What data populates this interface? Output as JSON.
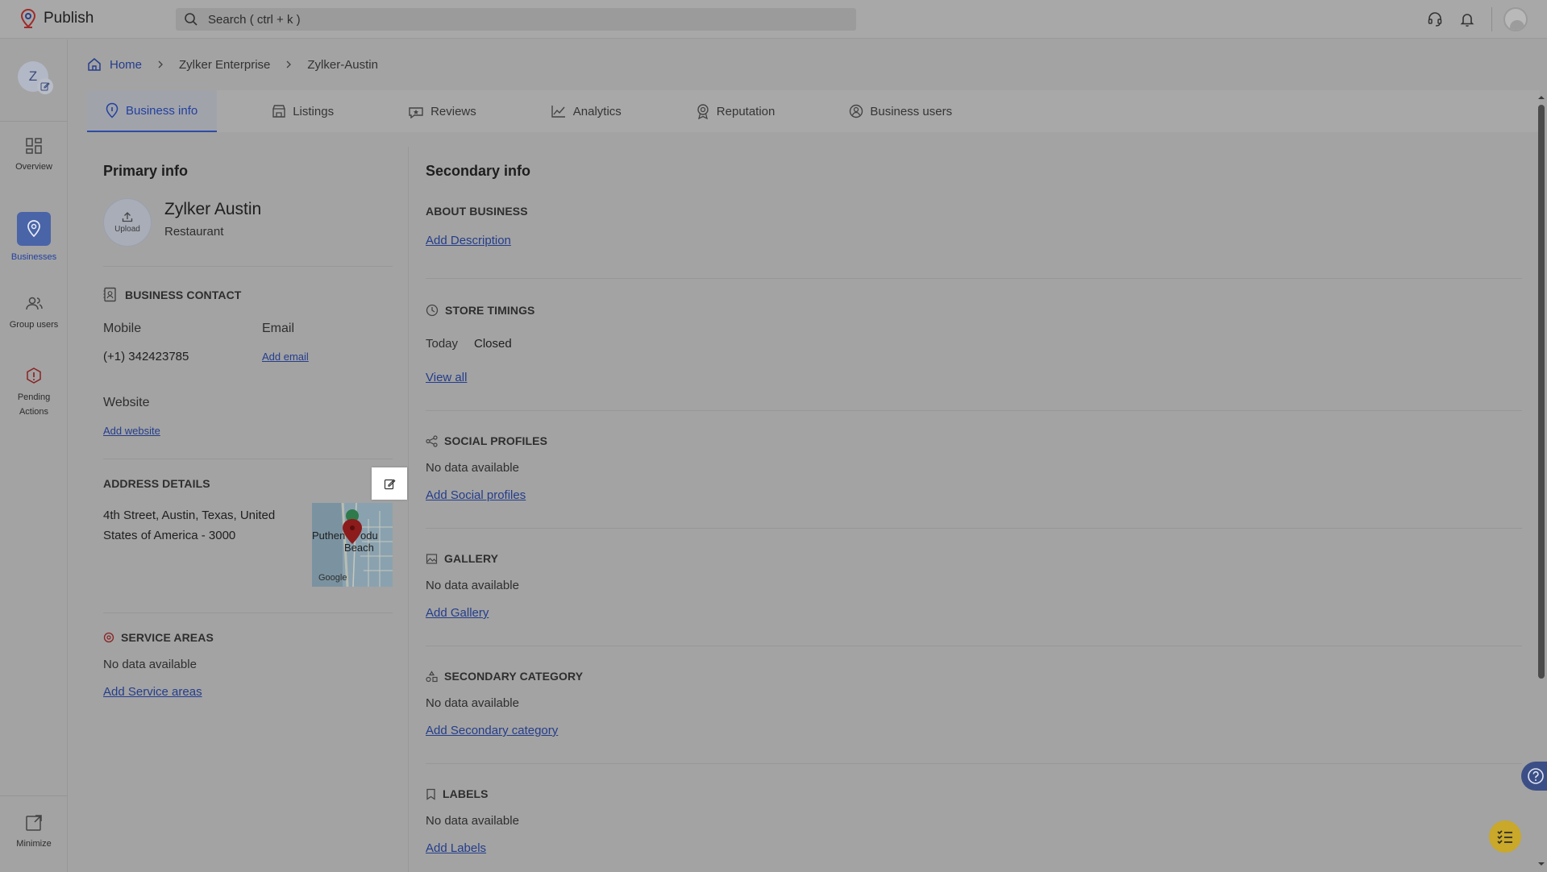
{
  "app": {
    "title": "Publish"
  },
  "search": {
    "placeholder": "Search ( ctrl + k )"
  },
  "rail": {
    "avatar_letter": "Z",
    "items": [
      {
        "label": "Overview",
        "icon": "grid-icon"
      },
      {
        "label": "Businesses",
        "icon": "location-pin-icon",
        "active": true
      },
      {
        "label": "Group users",
        "icon": "users-icon"
      },
      {
        "label": "Pending Actions",
        "icon": "alert-icon"
      }
    ],
    "minimize_label": "Minimize"
  },
  "breadcrumb": {
    "home": "Home",
    "level1": "Zylker Enterprise",
    "level2": "Zylker-Austin"
  },
  "tabs": [
    {
      "label": "Business info",
      "icon": "info-pin-icon",
      "active": true
    },
    {
      "label": "Listings",
      "icon": "store-icon"
    },
    {
      "label": "Reviews",
      "icon": "reviews-icon"
    },
    {
      "label": "Analytics",
      "icon": "analytics-icon"
    },
    {
      "label": "Reputation",
      "icon": "reputation-icon"
    },
    {
      "label": "Business users",
      "icon": "business-users-icon"
    }
  ],
  "primary": {
    "heading": "Primary info",
    "upload_label": "Upload",
    "business_name": "Zylker Austin",
    "business_category": "Restaurant",
    "contact": {
      "title": "BUSINESS CONTACT",
      "mobile_label": "Mobile",
      "mobile_value": "(+1) 342423785",
      "email_label": "Email",
      "email_link": "Add email",
      "website_label": "Website",
      "website_link": "Add website"
    },
    "address": {
      "title": "ADDRESS DETAILS",
      "line1": "4th Street, Austin, Texas, United",
      "line2": "States of America - 3000",
      "map_place": "Puthenthodu Beach",
      "map_place_line1": "Puthen",
      "map_place_line1b": "odu",
      "map_place_line2": "Beach",
      "map_brand": "Google"
    },
    "service_areas": {
      "title": "SERVICE AREAS",
      "empty": "No data available",
      "link": "Add Service areas"
    }
  },
  "secondary": {
    "heading": "Secondary info",
    "about": {
      "title": "ABOUT BUSINESS",
      "link": "Add Description"
    },
    "timings": {
      "title": "STORE TIMINGS",
      "day": "Today",
      "status": "Closed",
      "link": "View all"
    },
    "social": {
      "title": "SOCIAL PROFILES",
      "empty": "No data available",
      "link": "Add Social profiles"
    },
    "gallery": {
      "title": "GALLERY",
      "empty": "No data available",
      "link": "Add Gallery"
    },
    "category": {
      "title": "SECONDARY CATEGORY",
      "empty": "No data available",
      "link": "Add Secondary category"
    },
    "labels": {
      "title": "LABELS",
      "empty": "No data available",
      "link": "Add Labels"
    }
  },
  "colors": {
    "accent": "#2d4ba6",
    "link": "#243d8c",
    "fab": "#c9a82a"
  }
}
